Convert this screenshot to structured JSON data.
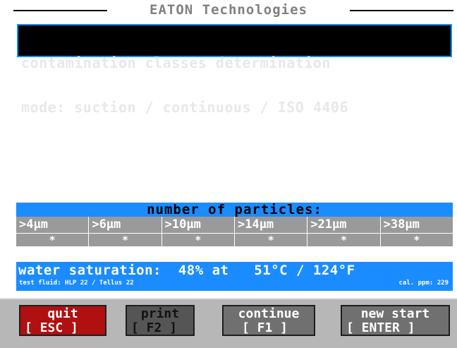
{
  "window": {
    "title": "EATON Technologies"
  },
  "header": {
    "line1": "contamination classes determination",
    "line2": "mode: suction / continuous / ISO 4406"
  },
  "particles": {
    "title": "number of particles:",
    "sizes": [
      ">4µm",
      ">6µm",
      ">10µm",
      ">14µm",
      ">21µm",
      ">38µm"
    ],
    "values": [
      "*",
      "*",
      "*",
      "*",
      "*",
      "*"
    ]
  },
  "water": {
    "main": "water saturation:  48% at   51°C / 124°F",
    "fluid": "test fluid: HLP 22 / Tellus 22",
    "cal": "cal. ppm: 229"
  },
  "buttons": {
    "quit": {
      "label": "quit",
      "key": "[ ESC ]"
    },
    "print": {
      "label": "print",
      "key": "[ F2 ]"
    },
    "continue": {
      "label": "continue",
      "key": "[ F1 ]"
    },
    "new_start": {
      "label": "new start",
      "key": "[ ENTER ]"
    }
  },
  "colors": {
    "accent_blue": "#1a8cff",
    "quit_red": "#b01010",
    "print_gray": "#555555",
    "continue_gray": "#707070",
    "new_start_gray": "#707070",
    "grid_gray": "#9a9a9a"
  }
}
